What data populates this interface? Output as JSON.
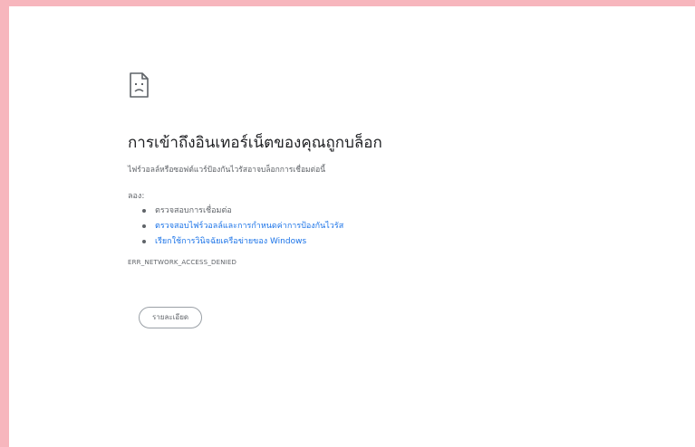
{
  "icon": "sad-page-icon",
  "title": "การเข้าถึงอินเทอร์เน็ตของคุณถูกบล็อก",
  "summary": "ไฟร์วอลล์หรือซอฟต์แวร์ป้องกันไวรัสอาจบล็อกการเชื่อมต่อนี้",
  "try_label": "ลอง:",
  "suggestions": [
    {
      "label": "ตรวจสอบการเชื่อมต่อ",
      "is_link": false
    },
    {
      "label": "ตรวจสอบไฟร์วอลล์และการกำหนดค่าการป้องกันไวรัส",
      "is_link": true
    },
    {
      "label": "เรียกใช้การวินิจฉัยเครือข่ายของ Windows",
      "is_link": true
    }
  ],
  "error_code": "ERR_NETWORK_ACCESS_DENIED",
  "details_button": "รายละเอียด",
  "colors": {
    "border": "#f7b6bd",
    "background": "#ffffff",
    "link": "#1a73e8",
    "text": "#5f6368"
  }
}
